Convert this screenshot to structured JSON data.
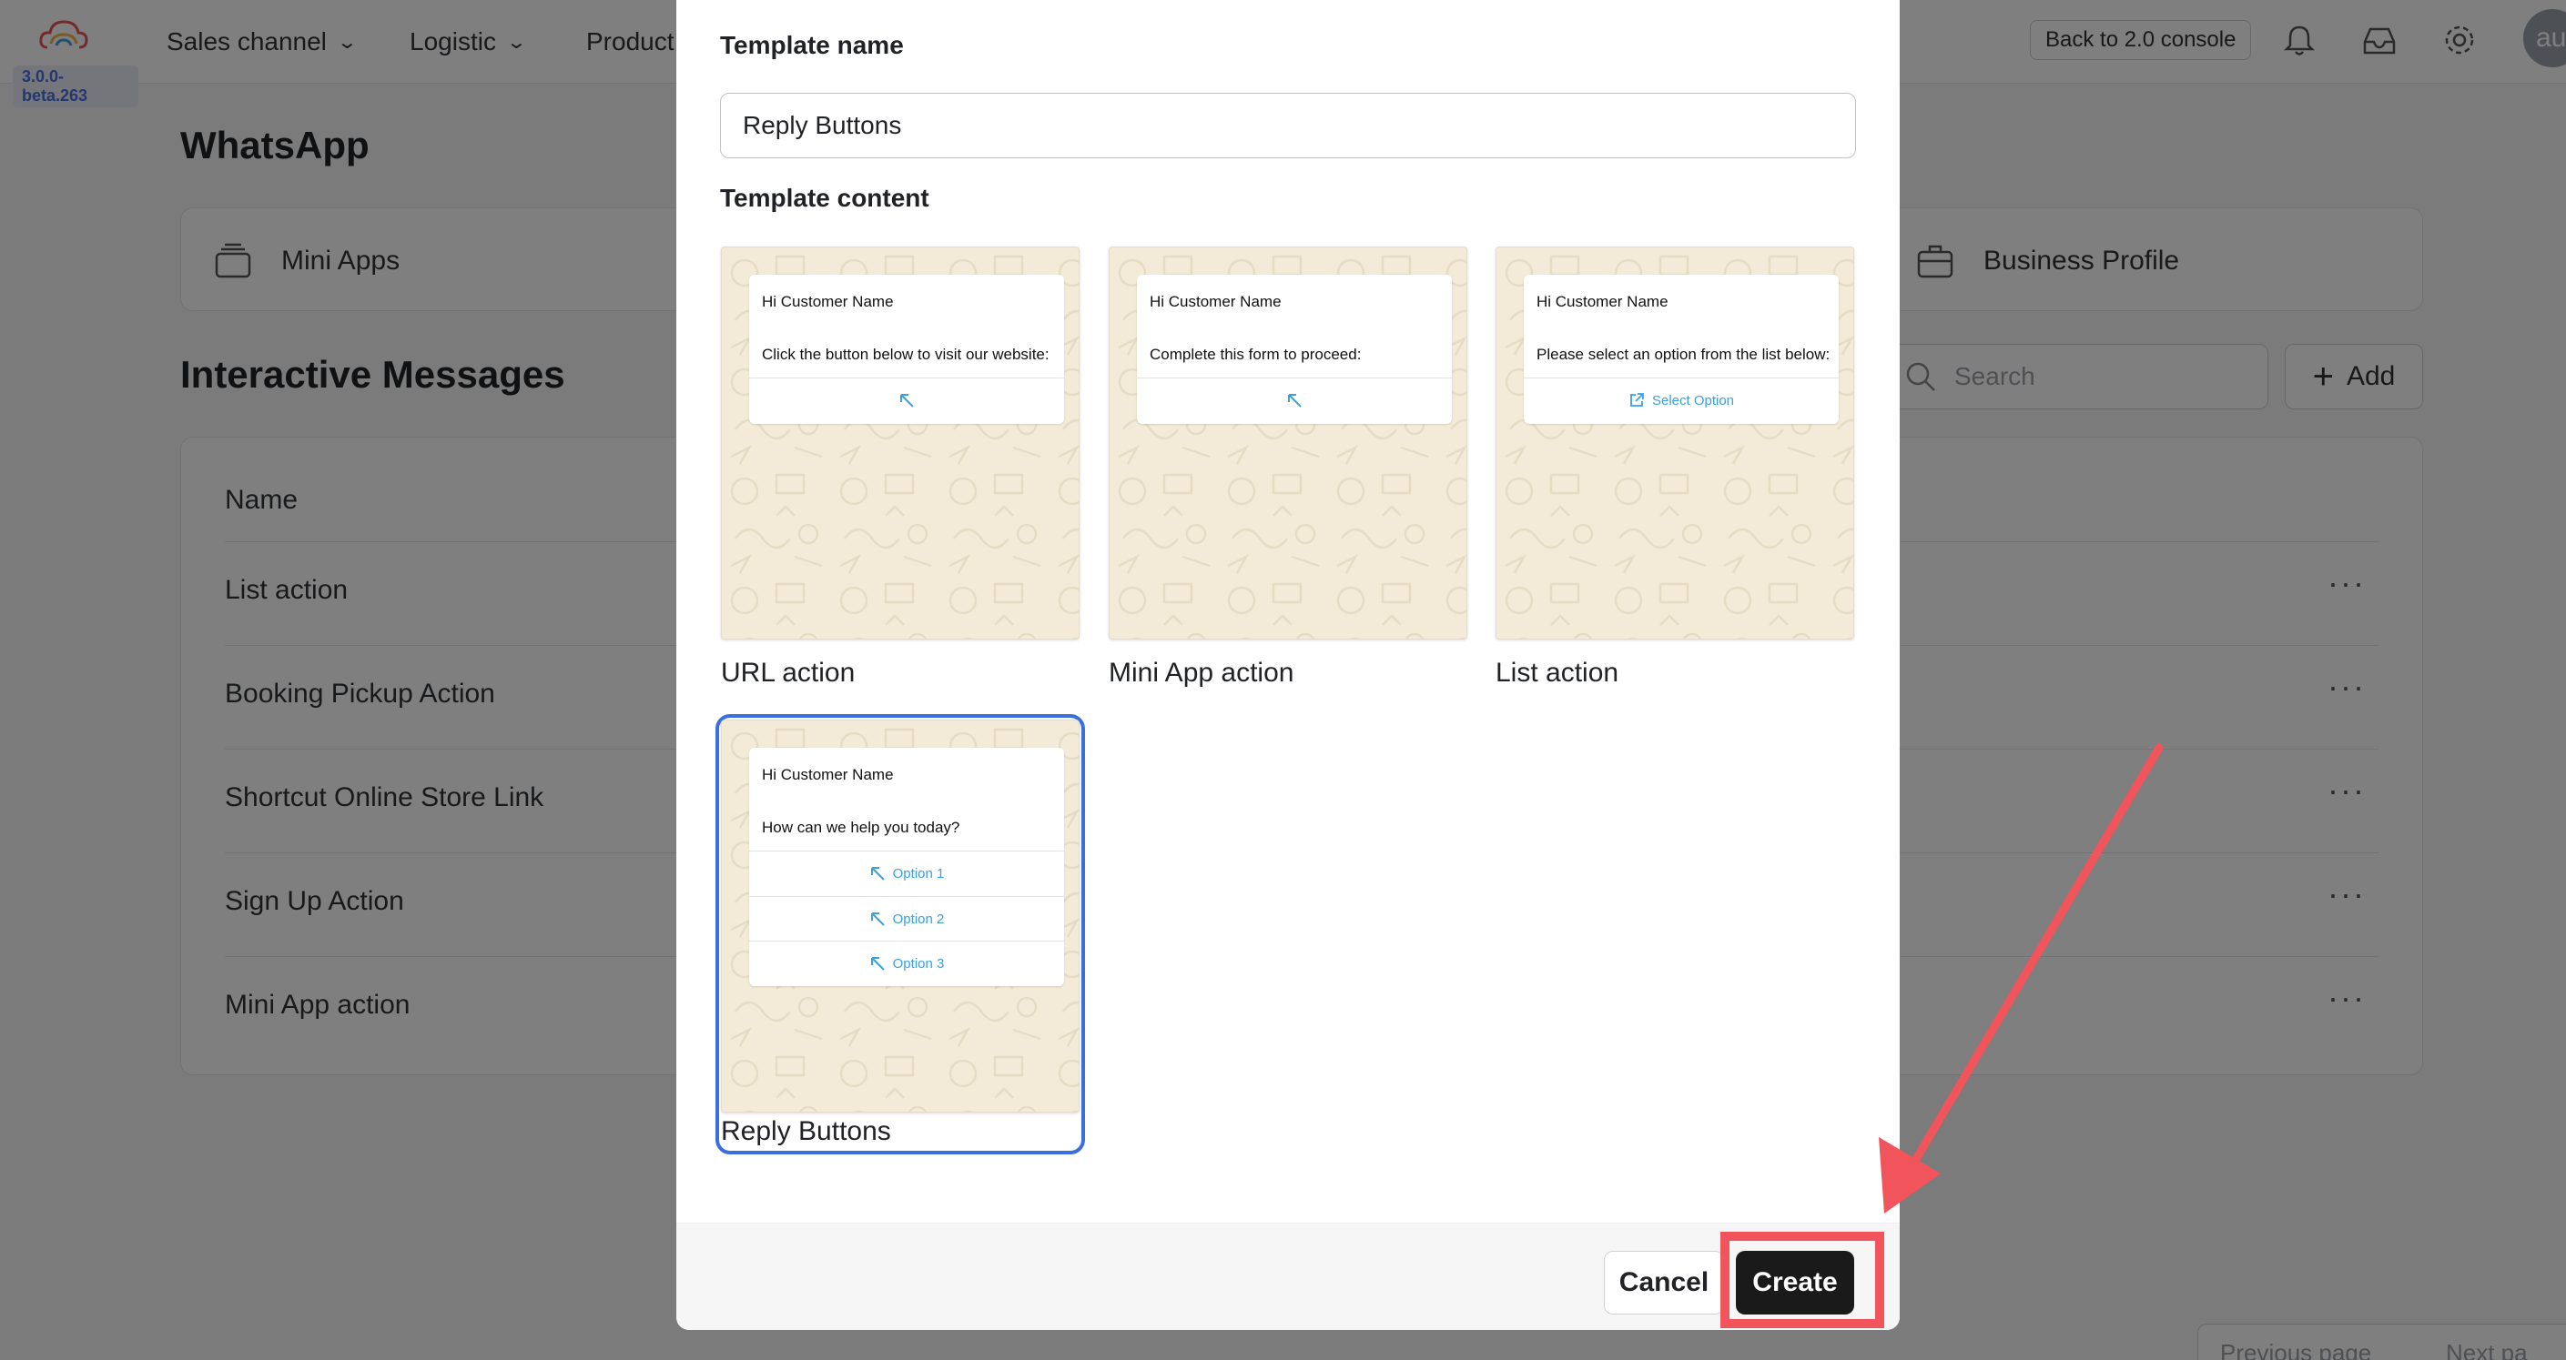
{
  "app": {
    "version": "3.0.0-beta.263",
    "nav": [
      {
        "label": "Sales channel"
      },
      {
        "label": "Logistic"
      },
      {
        "label": "Product"
      }
    ],
    "back_label": "Back to 2.0 console",
    "avatar_initials": "au"
  },
  "whatsapp": {
    "title": "WhatsApp",
    "cards": [
      {
        "label": "Mini Apps",
        "icon": "stack-icon"
      },
      {
        "label": "Business Profile",
        "icon": "briefcase-icon"
      }
    ]
  },
  "messages": {
    "title": "Interactive Messages",
    "search_placeholder": "Search",
    "add_label": "Add",
    "column_name": "Name",
    "rows": [
      {
        "name": "List action"
      },
      {
        "name": "Booking Pickup Action"
      },
      {
        "name": "Shortcut Online Store Link"
      },
      {
        "name": "Sign Up Action"
      },
      {
        "name": "Mini App action"
      }
    ],
    "more_label": "···",
    "pager": {
      "prev": "Previous page",
      "next": "Next pa"
    }
  },
  "modal": {
    "name_label": "Template name",
    "name_value": "Reply Buttons",
    "content_label": "Template content",
    "templates": [
      {
        "caption": "URL action",
        "hello": "Hi Customer Name",
        "body": "Click the button below to visit our website:",
        "actions": [
          ""
        ]
      },
      {
        "caption": "Mini App action",
        "hello": "Hi Customer Name",
        "body": "Complete this form to proceed:",
        "actions": [
          ""
        ]
      },
      {
        "caption": "List action",
        "hello": "Hi Customer Name",
        "body": "Please select an option from the list below:",
        "actions": [
          "Select Option"
        ]
      },
      {
        "caption": "Reply Buttons",
        "hello": "Hi Customer Name",
        "body": "How can we help you today?",
        "actions": [
          "Option 1",
          "Option 2",
          "Option 3"
        ],
        "selected": true
      }
    ],
    "cancel_label": "Cancel",
    "create_label": "Create"
  },
  "colors": {
    "accent_selected": "#3b6fe0",
    "annotation": "#f2545b",
    "link": "#3aa0e0",
    "primary_button": "#1a1a1a"
  }
}
